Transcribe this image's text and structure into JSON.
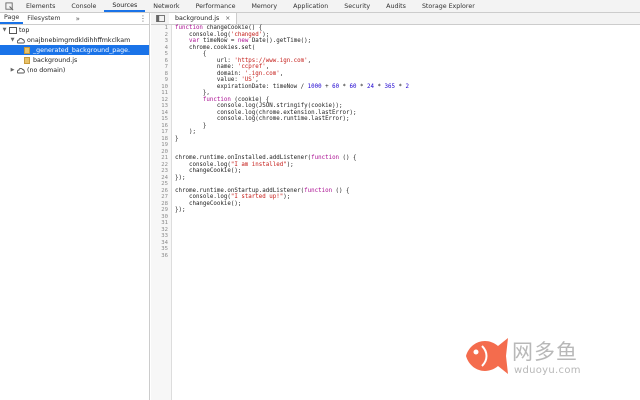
{
  "top_tabs": [
    "Elements",
    "Console",
    "Sources",
    "Network",
    "Performance",
    "Memory",
    "Application",
    "Security",
    "Audits",
    "Storage Explorer"
  ],
  "active_top_tab": "Sources",
  "navigator": {
    "tabs": [
      "Page",
      "Filesystem"
    ],
    "more_glyph": "»",
    "menu_glyph": "⋮",
    "tree": [
      {
        "label": "top",
        "indent": 0,
        "arrow": "▼",
        "icon": "frame-icon"
      },
      {
        "label": "onajbnebimgmdkldihhffmkclkam",
        "indent": 1,
        "arrow": "▼",
        "icon": "cloud-icon"
      },
      {
        "label": "_generated_background_page.",
        "indent": 2,
        "arrow": "",
        "icon": "file-icon",
        "selected": true
      },
      {
        "label": "background.js",
        "indent": 2,
        "arrow": "",
        "icon": "file-icon"
      },
      {
        "label": "(no domain)",
        "indent": 1,
        "arrow": "▶",
        "icon": "cloud-icon"
      }
    ]
  },
  "editor": {
    "file_tab": "background.js",
    "close_glyph": "×",
    "line_count": 36,
    "lines": [
      "function changeCookie() {",
      "    console.log('changed');",
      "    var timeNow = new Date().getTime();",
      "    chrome.cookies.set(",
      "        {",
      "            url: 'https://www.ign.com',",
      "            name: 'ccpref',",
      "            domain: '.ign.com',",
      "            value: 'US',",
      "            expirationDate: timeNow / 1000 + 60 * 60 * 24 * 365 * 2",
      "        },",
      "        function (cookie) {",
      "            console.log(JSON.stringify(cookie));",
      "            console.log(chrome.extension.lastError);",
      "            console.log(chrome.runtime.lastError);",
      "        }",
      "    );",
      "}",
      "",
      "",
      "chrome.runtime.onInstalled.addListener(function () {",
      "    console.log(\"I am installed\");",
      "    changeCookie();",
      "});",
      "",
      "chrome.runtime.onStartup.addListener(function () {",
      "    console.log(\"I started up!\");",
      "    changeCookie();",
      "});",
      "",
      "",
      "",
      "",
      "",
      "",
      ""
    ]
  },
  "watermark": {
    "title": "网多鱼",
    "url": "wduoyu.com"
  },
  "colors": {
    "accent": "#1a73e8",
    "keyword": "#aa0d91",
    "string": "#c41a16",
    "number": "#1c00cf",
    "logo": "#f46c4d"
  }
}
